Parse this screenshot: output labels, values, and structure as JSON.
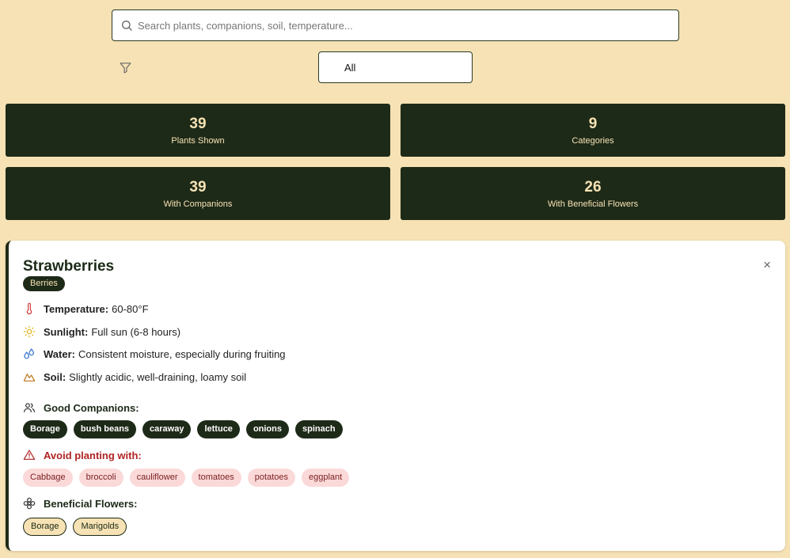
{
  "search": {
    "placeholder": "Search plants, companions, soil, temperature..."
  },
  "filter": {
    "selected": "All"
  },
  "stats": [
    {
      "value": "39",
      "label": "Plants Shown"
    },
    {
      "value": "9",
      "label": "Categories"
    },
    {
      "value": "39",
      "label": "With Companions"
    },
    {
      "value": "26",
      "label": "With Beneficial Flowers"
    }
  ],
  "plant": {
    "name": "Strawberries",
    "category": "Berries",
    "close_label": "×",
    "temperature_label": "Temperature:",
    "temperature": "60-80°F",
    "sunlight_label": "Sunlight:",
    "sunlight": "Full sun (6-8 hours)",
    "water_label": "Water:",
    "water": "Consistent moisture, especially during fruiting",
    "soil_label": "Soil:",
    "soil": "Slightly acidic, well-draining, loamy soil",
    "companions_title": "Good Companions:",
    "companions": [
      "Borage",
      "bush beans",
      "caraway",
      "lettuce",
      "onions",
      "spinach"
    ],
    "avoid_title": "Avoid planting with:",
    "avoid": [
      "Cabbage",
      "broccoli",
      "cauliflower",
      "tomatoes",
      "potatoes",
      "eggplant"
    ],
    "flowers_title": "Beneficial Flowers:",
    "flowers": [
      "Borage",
      "Marigolds"
    ]
  },
  "icons": {
    "search": "search-icon",
    "filter": "filter-icon",
    "temperature": "thermometer-icon",
    "sunlight": "sun-icon",
    "water": "droplets-icon",
    "soil": "mountain-icon",
    "companions": "users-icon",
    "avoid": "warning-triangle-icon",
    "flowers": "flower-icon"
  },
  "colors": {
    "background": "#f6e2b4",
    "dark": "#1e2a18",
    "warning": "#b02323",
    "avoid_bg": "#fbd9d9"
  }
}
